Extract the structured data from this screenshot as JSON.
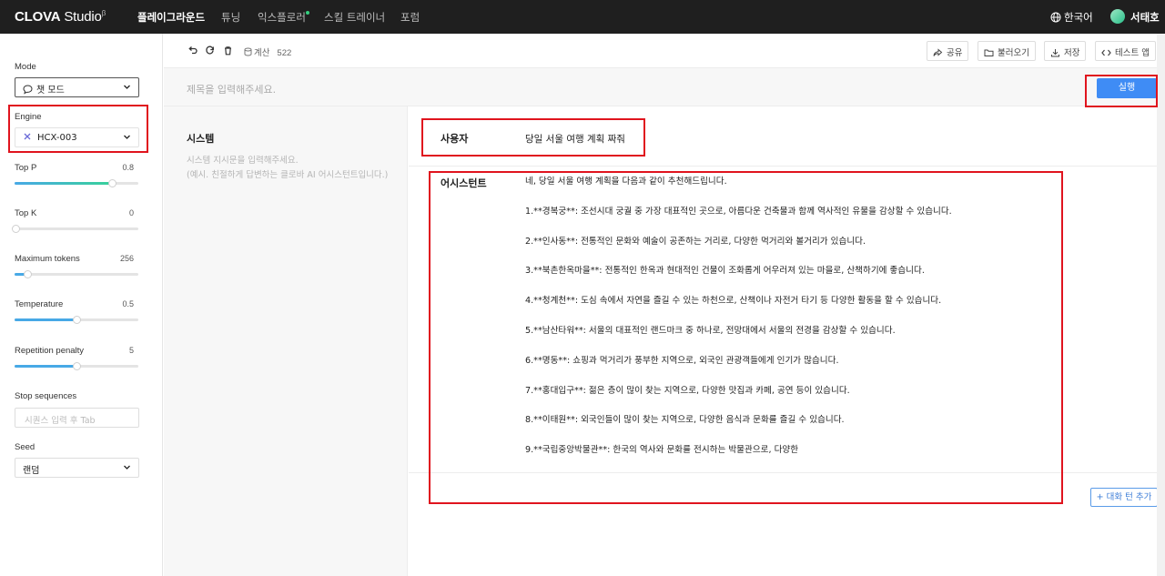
{
  "topbar": {
    "logo": "CLOVA Studio",
    "nav": [
      "플레이그라운드",
      "튜닝",
      "익스플로러",
      "스킬 트레이너",
      "포럼"
    ],
    "language": "한국어",
    "user_name": "서태호"
  },
  "sidebar": {
    "mode_label": "Mode",
    "mode_value": "챗 모드",
    "engine_label": "Engine",
    "engine_value": "HCX-003",
    "params": [
      {
        "label": "Top P",
        "value": "0.8",
        "level": 0.8
      },
      {
        "label": "Top K",
        "value": "0",
        "level": 0
      },
      {
        "label": "Maximum tokens",
        "value": "256",
        "level": 0.1
      },
      {
        "label": "Temperature",
        "value": "0.5",
        "level": 0.5
      },
      {
        "label": "Repetition penalty",
        "value": "5",
        "level": 0.5
      }
    ],
    "stop_label": "Stop sequences",
    "stop_placeholder": "시퀀스 입력 후 Tab",
    "seed_label": "Seed",
    "seed_value": "랜덤"
  },
  "toolbar": {
    "token_label": "계산",
    "token_count": "522",
    "share": "공유",
    "load": "불러오기",
    "save": "저장",
    "test_app": "테스트 앱"
  },
  "title_placeholder": "제목을 입력해주세요.",
  "run_button": "실행",
  "system": {
    "label": "시스템",
    "placeholder": "시스템 지시문을 입력해주세요.\n(예시. 친절하게 답변하는 클로바 AI 어시스턴트입니다.)"
  },
  "chat": {
    "user_role": "사용자",
    "user_message": "당일 서울 여행 계획 짜줘",
    "assistant_role": "어시스턴트",
    "assistant_lines": [
      "네, 당일 서울 여행 계획을 다음과 같이 추천해드립니다.",
      "1.**경복궁**: 조선시대 궁궐 중 가장 대표적인 곳으로, 아름다운 건축물과 함께 역사적인 유물을 감상할 수 있습니다.",
      "2.**인사동**: 전통적인 문화와 예술이 공존하는 거리로, 다양한 먹거리와 볼거리가 있습니다.",
      "3.**북촌한옥마을**: 전통적인 한옥과 현대적인 건물이 조화롭게 어우러져 있는 마을로, 산책하기에 좋습니다.",
      "4.**청계천**: 도심 속에서 자연을 즐길 수 있는 하천으로, 산책이나 자전거 타기 등 다양한 활동을 할 수 있습니다.",
      "5.**남산타워**: 서울의 대표적인 랜드마크 중 하나로, 전망대에서 서울의 전경을 감상할 수 있습니다.",
      "6.**명동**: 쇼핑과 먹거리가 풍부한 지역으로, 외국인 관광객들에게 인기가 많습니다.",
      "7.**홍대입구**: 젊은 층이 많이 찾는 지역으로, 다양한 맛집과 카페, 공연 등이 있습니다.",
      "8.**이태원**: 외국인들이 많이 찾는 지역으로, 다양한 음식과 문화를 즐길 수 있습니다.",
      "9.**국립중앙박물관**: 한국의 역사와 문화를 전시하는 박물관으로, 다양한"
    ],
    "add_turn": "+ 대화 턴 추가"
  },
  "colors": {
    "accent": "#3f8cf5",
    "highlight": "#e0141e",
    "slider": "#48a9e6"
  }
}
